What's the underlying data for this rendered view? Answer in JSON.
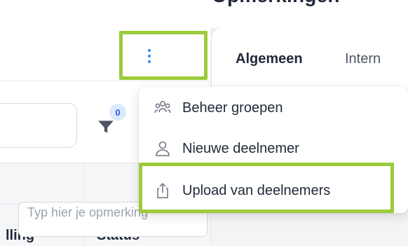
{
  "header": {
    "title_clipped": "Opmerkingen"
  },
  "toolbar": {
    "more_actions_icon": "kebab-vertical-icon",
    "filter_icon": "filter-funnel-icon",
    "filter_count": "0"
  },
  "table": {
    "columns": [
      "lling",
      "Status"
    ]
  },
  "comments": {
    "tabs": [
      {
        "label": "Algemeen",
        "active": true
      },
      {
        "label": "Intern",
        "active": false
      }
    ],
    "placeholder": "Typ hier je opmerking"
  },
  "dropdown_menu": {
    "items": [
      {
        "label": "Beheer groepen",
        "icon": "users-group-icon"
      },
      {
        "label": "Nieuwe deelnemer",
        "icon": "user-icon"
      },
      {
        "label": "Upload van deelnemers",
        "icon": "upload-icon"
      }
    ]
  },
  "colors": {
    "highlight": "#9ccb3b",
    "accent": "#3b82f6",
    "badge_bg": "#dbeafe",
    "text": "#1f2937"
  }
}
